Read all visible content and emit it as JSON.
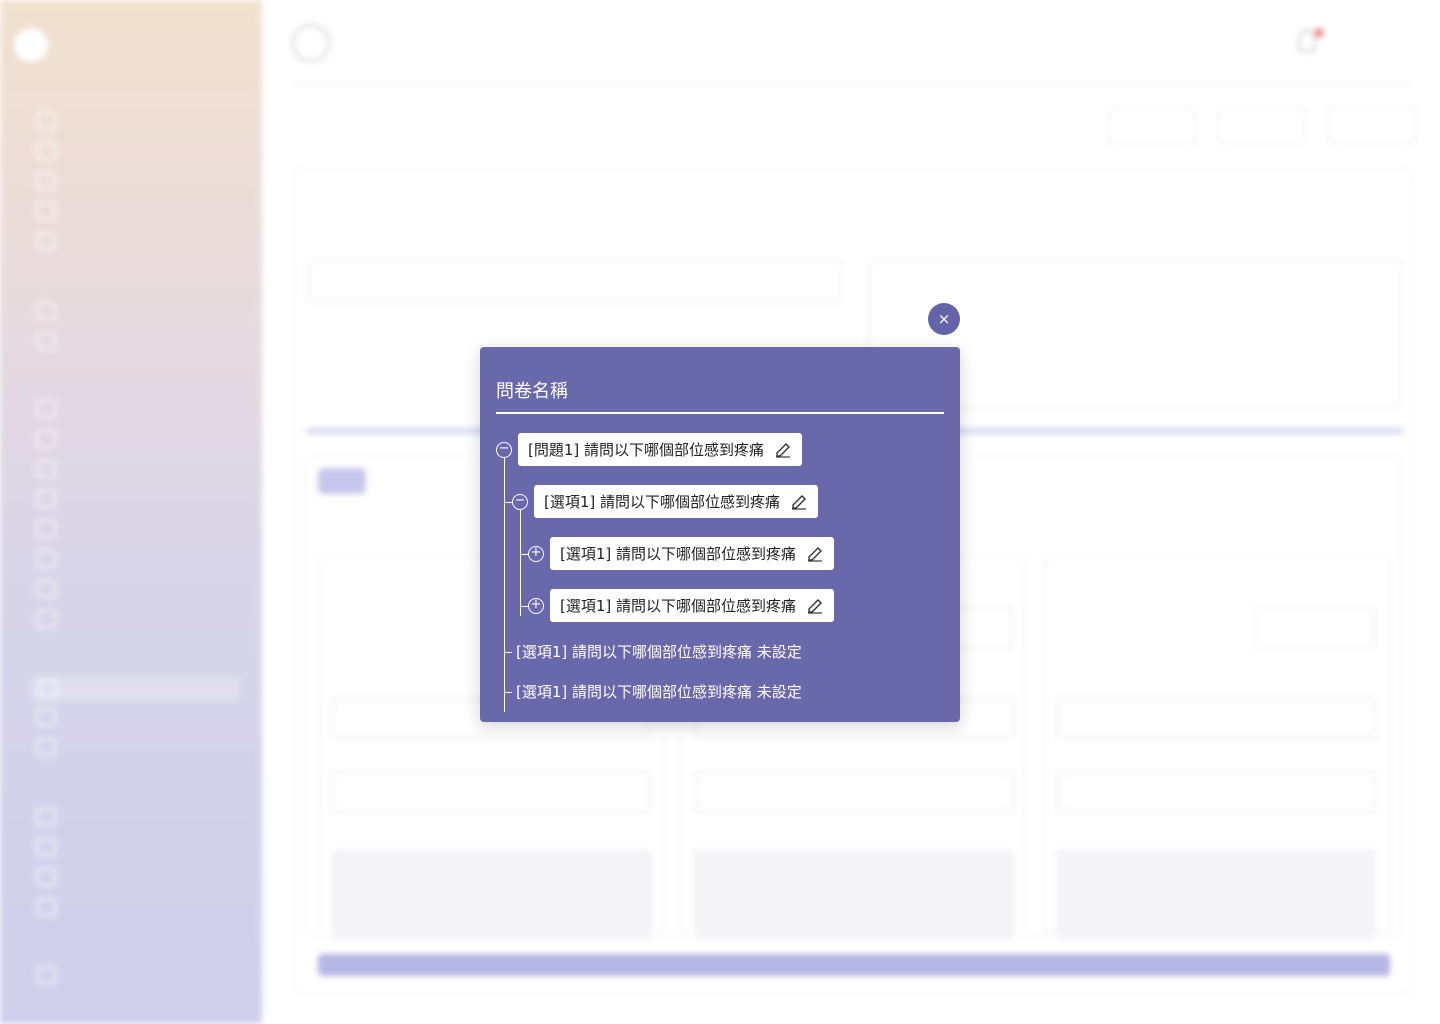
{
  "modal": {
    "title": "問卷名稱",
    "close_icon": "×",
    "tree": {
      "root": "[問題1] 請問以下哪個部位感到疼痛",
      "child1": "[選項1] 請問以下哪個部位感到疼痛",
      "grand1": "[選項1] 請問以下哪個部位感到疼痛",
      "grand2": "[選項1] 請問以下哪個部位感到疼痛",
      "unset1": "[選項1] 請問以下哪個部位感到疼痛 未設定",
      "unset2": "[選項1] 請問以下哪個部位感到疼痛 未設定"
    },
    "colors": {
      "panel": "#6868aa",
      "node_bg": "#ffffff"
    }
  }
}
